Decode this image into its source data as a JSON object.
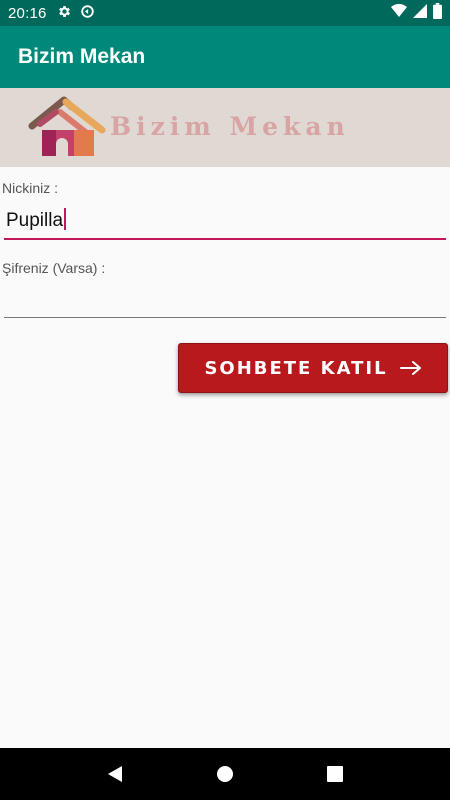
{
  "status_bar": {
    "time": "20:16",
    "left_icons": [
      "gear-icon",
      "data-saver-icon"
    ],
    "right_icons": [
      "wifi-icon",
      "signal-icon",
      "battery-icon"
    ]
  },
  "app_bar": {
    "title": "Bizim Mekan"
  },
  "banner": {
    "text": "Bizim Mekan",
    "logo_icon": "house-logo"
  },
  "form": {
    "nick_label": "Nickiniz :",
    "nick_value": "Pupilla",
    "password_label": "Şifreniz (Varsa) :",
    "password_value": "",
    "join_button_label": "SOHBETE KATIL"
  },
  "nav_bar": {
    "buttons": [
      "back-icon",
      "home-icon",
      "recents-icon"
    ]
  },
  "colors": {
    "status_bar": "#00695c",
    "app_bar": "#00897b",
    "accent": "#c2185b",
    "button": "#b7191c",
    "banner_bg": "#e0d8d3",
    "banner_text": "#d8a4a4"
  }
}
